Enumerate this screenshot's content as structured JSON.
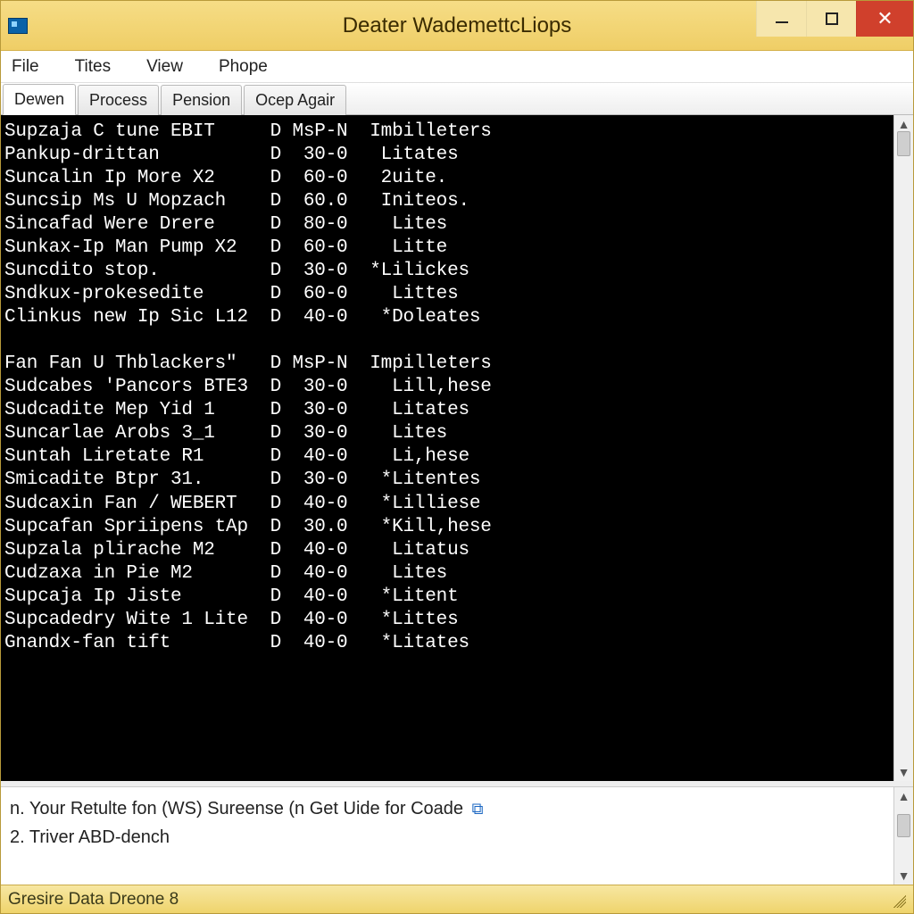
{
  "window": {
    "title": "Deater WademettcLiops"
  },
  "menu": {
    "items": [
      "File",
      "Tites",
      "View",
      "Phope"
    ]
  },
  "tabs": {
    "items": [
      "Dewen",
      "Process",
      "Pension",
      "Ocep Agair"
    ],
    "active_index": 0
  },
  "terminal": {
    "rows": [
      {
        "name": "Supzaja C tune EBIT",
        "d": "D",
        "m": "MsP-N",
        "status": "Imbilleters"
      },
      {
        "name": "Pankup-drittan",
        "d": "D",
        "m": " 30-0",
        "status": " Litates"
      },
      {
        "name": "Suncalin Ip More X2",
        "d": "D",
        "m": " 60-0",
        "status": " 2uite."
      },
      {
        "name": "Suncsip Ms U Mopzach",
        "d": "D",
        "m": " 60.0",
        "status": " Initeos."
      },
      {
        "name": "Sincafad Were Drere",
        "d": "D",
        "m": " 80-0",
        "status": "  Lites"
      },
      {
        "name": "Sunkax-Ip Man Pump X2",
        "d": "D",
        "m": " 60-0",
        "status": "  Litte"
      },
      {
        "name": "Suncdito stop.",
        "d": "D",
        "m": " 30-0",
        "status": "*Lilickes"
      },
      {
        "name": "Sndkux-prokesedite",
        "d": "D",
        "m": " 60-0",
        "status": "  Littes"
      },
      {
        "name": "Clinkus new Ip Sic L12",
        "d": "D",
        "m": " 40-0",
        "status": " *Doleates"
      },
      {
        "name": "",
        "d": "",
        "m": "",
        "status": ""
      },
      {
        "name": "Fan Fan U Thblackers\"",
        "d": "D",
        "m": "MsP-N",
        "status": "Impilleters"
      },
      {
        "name": "Sudcabes 'Pancors BTE3",
        "d": "D",
        "m": " 30-0",
        "status": "  Lill,hese"
      },
      {
        "name": "Sudcadite Mep Yid 1",
        "d": "D",
        "m": " 30-0",
        "status": "  Litates"
      },
      {
        "name": "Suncarlae Arobs 3_1",
        "d": "D",
        "m": " 30-0",
        "status": "  Lites"
      },
      {
        "name": "Suntah Liretate R1",
        "d": "D",
        "m": " 40-0",
        "status": "  Li,hese"
      },
      {
        "name": "Smicadite Btpr 31.",
        "d": "D",
        "m": " 30-0",
        "status": " *Litentes"
      },
      {
        "name": "Sudcaxin Fan / WEBERT",
        "d": "D",
        "m": " 40-0",
        "status": " *Lilliese"
      },
      {
        "name": "Supcafan Spriipens tAp",
        "d": "D",
        "m": " 30.0",
        "status": " *Kill,hese"
      },
      {
        "name": "Supzala plirache M2",
        "d": "D",
        "m": " 40-0",
        "status": "  Litatus"
      },
      {
        "name": "Cudzaxa in Pie M2",
        "d": "D",
        "m": " 40-0",
        "status": "  Lites"
      },
      {
        "name": "Supcaja Ip Jiste",
        "d": "D",
        "m": " 40-0",
        "status": " *Litent"
      },
      {
        "name": "Supcadedry Wite 1 Lite",
        "d": "D",
        "m": " 40-0",
        "status": " *Littes"
      },
      {
        "name": "Gnandx-fan tift",
        "d": "D",
        "m": " 40-0",
        "status": " *Litates"
      }
    ]
  },
  "bottom": {
    "line1": "n. Your Retulte fon (WS) Sureense (n Get Uide for Coade",
    "line2": "2. Triver ABD-dench"
  },
  "status": {
    "text": "Gresire Data Dreone 8"
  }
}
